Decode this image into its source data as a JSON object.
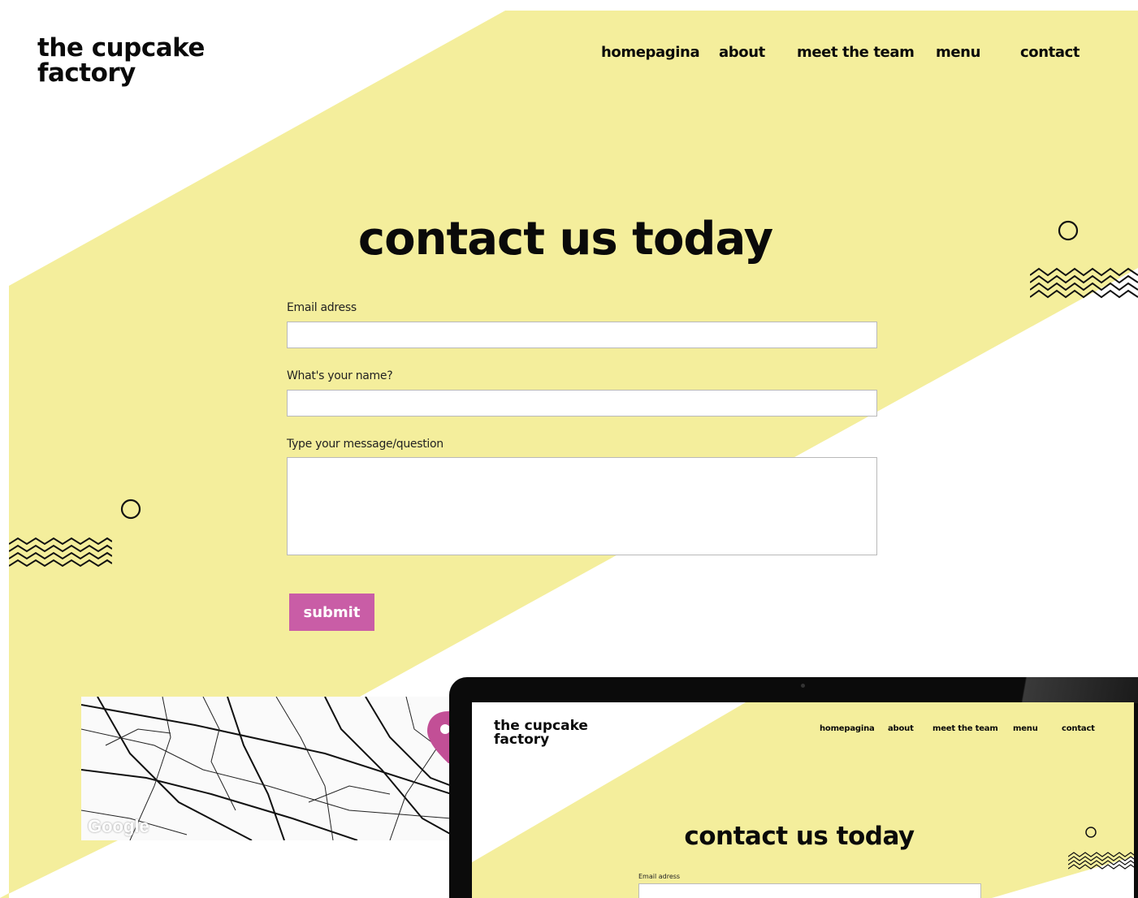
{
  "brand": {
    "line1": "the cupcake",
    "line2": "factory"
  },
  "nav": {
    "items": [
      "homepagina",
      "about",
      "meet the team",
      "menu",
      "contact"
    ]
  },
  "hero": {
    "title": "contact us today"
  },
  "form": {
    "email_label": "Email adress",
    "email_value": "",
    "name_label": "What's your name?",
    "name_value": "",
    "message_label": "Type your message/question",
    "message_value": "",
    "submit_label": "submit"
  },
  "map": {
    "provider_label": "Google"
  },
  "preview": {
    "brand": {
      "line1": "the cupcake",
      "line2": "factory"
    },
    "nav": {
      "items": [
        "homepagina",
        "about",
        "meet the team",
        "menu",
        "contact"
      ]
    },
    "title": "contact us today",
    "email_label": "Email adress"
  },
  "colors": {
    "background": "#ffffff",
    "accent_yellow": "#f4ee9c",
    "button_pink": "#c95da6",
    "map_pin": "#c24f96",
    "text": "#0a0a0a"
  },
  "icons": [
    "circle-icon",
    "zigzag-icon",
    "map-pin-icon",
    "camera-dot-icon"
  ]
}
